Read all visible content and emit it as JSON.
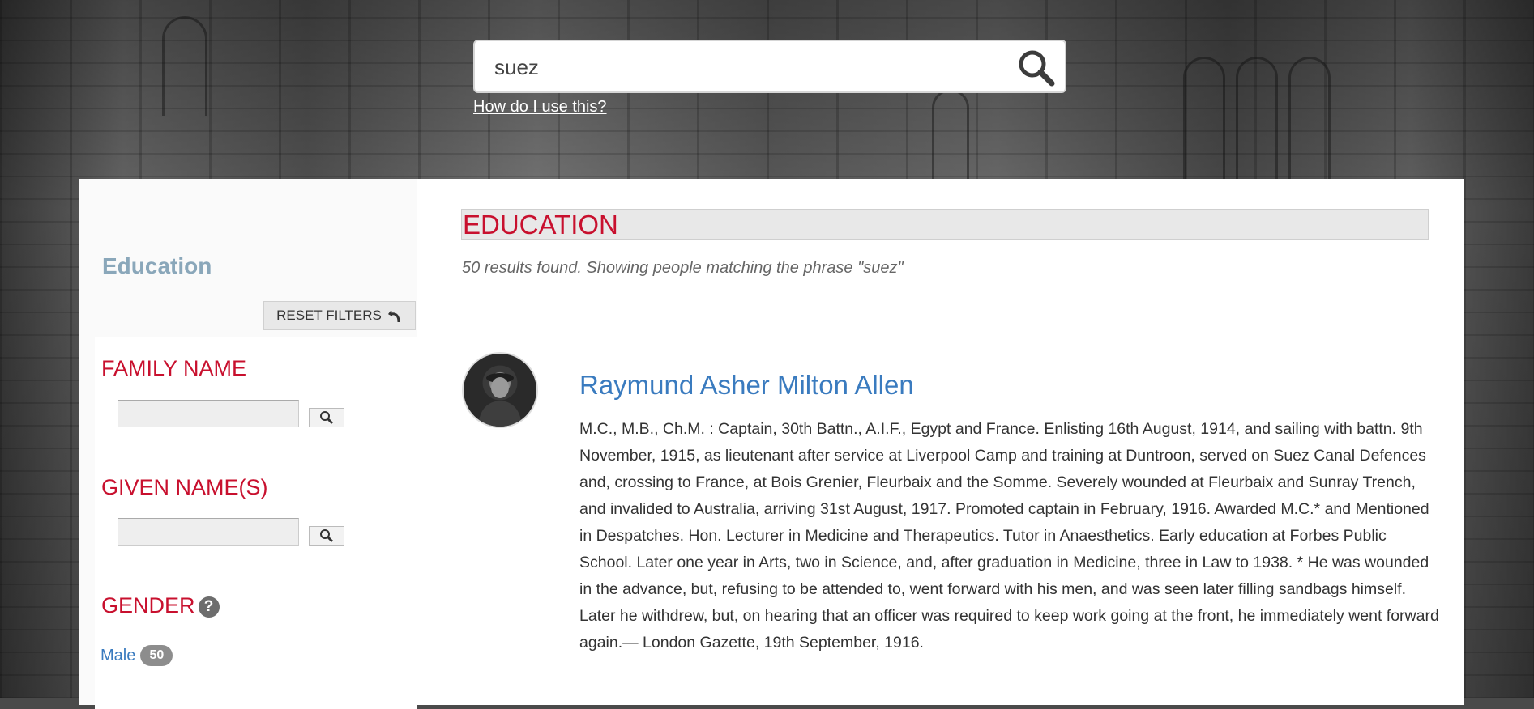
{
  "search": {
    "value": "suez",
    "help_link": "How do I use this?"
  },
  "sidebar": {
    "title": "Education",
    "reset_label": "RESET FILTERS",
    "filters": {
      "family_name": "FAMILY NAME",
      "given_names": "GIVEN NAME(S)",
      "gender": "GENDER",
      "gender_help": "?"
    },
    "gender_options": [
      {
        "label": "Male",
        "count": "50"
      }
    ]
  },
  "content": {
    "heading": "EDUCATION",
    "summary": "50 results found. Showing people matching the phrase \"suez\"",
    "results": [
      {
        "name": "Raymund Asher Milton Allen",
        "bio": "M.C., M.B., Ch.M. : Captain, 30th Battn., A.I.F., Egypt and France. Enlisting 16th August, 1914, and sailing with battn. 9th November, 1915, as lieutenant after service at Liverpool Camp and training at Duntroon, served on Suez Canal Defences and, crossing to France, at Bois Grenier, Fleurbaix and the Somme. Severely wounded at Fleurbaix and Sunray Trench, and invalided to Australia, arriving 31st August, 1917. Promoted captain in February, 1916. Awarded M.C.* and Mentioned in Despatches. Hon. Lecturer in Medicine and Therapeutics. Tutor in Anaesthetics. Early education at Forbes Public School. Later one year in Arts, two in Science, and, after graduation in Medicine, three in Law to 1938. * He was wounded in the advance, but, refusing to be attended to, went forward with his men, and was seen later filling sandbags himself. Later he withdrew, but, on hearing that an officer was required to keep work going at the front, he immediately went forward again.— London Gazette, 19th September, 1916."
      }
    ]
  },
  "colors": {
    "accent_red": "#c8102e",
    "link_blue": "#3a7bbf",
    "sidebar_title": "#8aa7ba"
  }
}
